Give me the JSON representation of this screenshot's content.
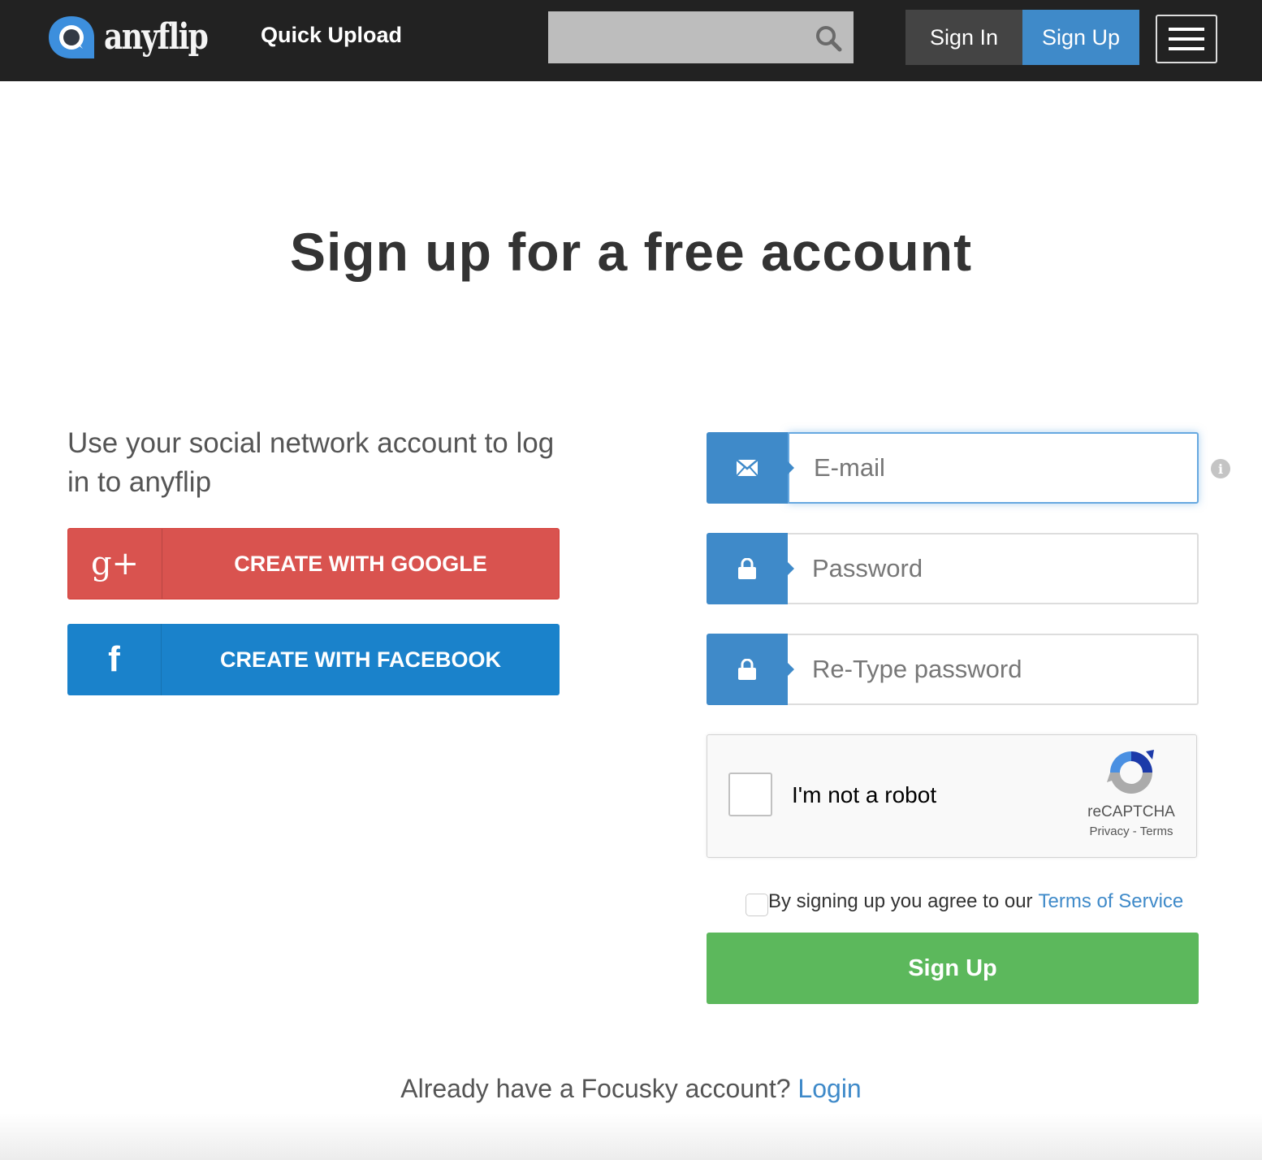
{
  "header": {
    "logo_text": "anyflip",
    "quick_upload": "Quick Upload",
    "search_placeholder": "",
    "sign_in": "Sign In",
    "sign_up": "Sign Up"
  },
  "page": {
    "title": "Sign up for a free account"
  },
  "social": {
    "intro": "Use your social network account to log in to anyflip",
    "google_label": "CREATE WITH GOOGLE",
    "google_icon": "g+",
    "facebook_label": "CREATE WITH FACEBOOK",
    "facebook_icon": "f"
  },
  "form": {
    "email_placeholder": "E-mail",
    "password_placeholder": "Password",
    "retype_placeholder": "Re-Type password",
    "info_glyph": "i",
    "captcha": {
      "label": "I'm not a robot",
      "brand": "reCAPTCHA",
      "privacy": "Privacy",
      "separator": " - ",
      "terms": "Terms"
    },
    "agree_text": "By signing up you agree to our",
    "tos_link": "Terms of Service",
    "submit": "Sign Up"
  },
  "footer": {
    "already_text": "Already have a Focusky account?",
    "login_link": "Login"
  },
  "colors": {
    "topbar": "#222222",
    "accent_blue": "#3f8ac9",
    "google_red": "#d9534f",
    "facebook_blue": "#1a82cb",
    "signup_green": "#5cb85c"
  }
}
